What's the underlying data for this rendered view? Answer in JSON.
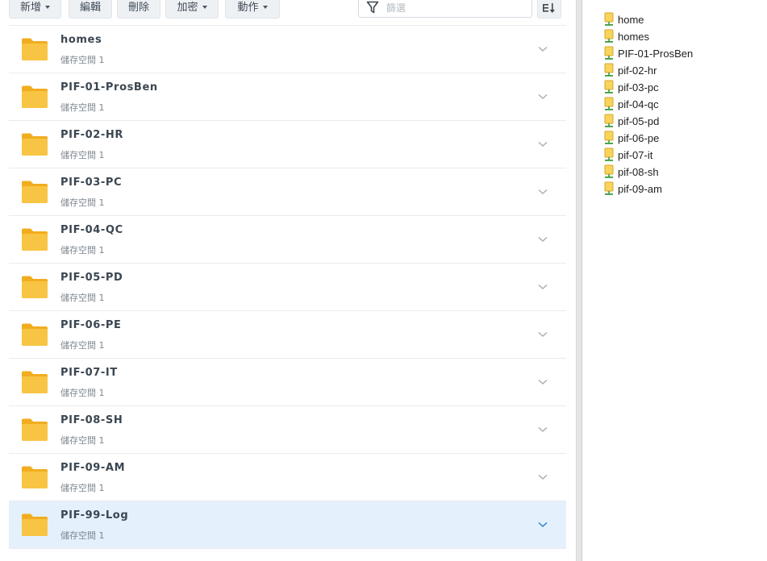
{
  "toolbar": {
    "create_label": "新增",
    "edit_label": "編輯",
    "delete_label": "刪除",
    "encrypt_label": "加密",
    "action_label": "動作",
    "search_placeholder": "篩選"
  },
  "folders": [
    {
      "name": "homes",
      "storage": "儲存空間 1",
      "selected": false
    },
    {
      "name": "PIF-01-ProsBen",
      "storage": "儲存空間 1",
      "selected": false
    },
    {
      "name": "PIF-02-HR",
      "storage": "儲存空間 1",
      "selected": false
    },
    {
      "name": "PIF-03-PC",
      "storage": "儲存空間 1",
      "selected": false
    },
    {
      "name": "PIF-04-QC",
      "storage": "儲存空間 1",
      "selected": false
    },
    {
      "name": "PIF-05-PD",
      "storage": "儲存空間 1",
      "selected": false
    },
    {
      "name": "PIF-06-PE",
      "storage": "儲存空間 1",
      "selected": false
    },
    {
      "name": "PIF-07-IT",
      "storage": "儲存空間 1",
      "selected": false
    },
    {
      "name": "PIF-08-SH",
      "storage": "儲存空間 1",
      "selected": false
    },
    {
      "name": "PIF-09-AM",
      "storage": "儲存空間 1",
      "selected": false
    },
    {
      "name": "PIF-99-Log",
      "storage": "儲存空間 1",
      "selected": true
    }
  ],
  "network_shares": [
    {
      "label": "home",
      "icon": "network-share-icon"
    },
    {
      "label": "homes",
      "icon": "network-share-icon"
    },
    {
      "label": "PIF-01-ProsBen",
      "icon": "network-share-icon"
    },
    {
      "label": "pif-02-hr",
      "icon": "network-share-icon"
    },
    {
      "label": "pif-03-pc",
      "icon": "network-share-icon"
    },
    {
      "label": "pif-04-qc",
      "icon": "network-share-icon"
    },
    {
      "label": "pif-05-pd",
      "icon": "network-share-icon"
    },
    {
      "label": "pif-06-pe",
      "icon": "network-share-icon"
    },
    {
      "label": "pif-07-it",
      "icon": "network-share-icon"
    },
    {
      "label": "pif-08-sh",
      "icon": "network-share-icon"
    },
    {
      "label": "pif-09-am",
      "icon": "network-share-icon"
    }
  ],
  "colors": {
    "folder": "#f8c443",
    "folder_dark": "#f1ad1f",
    "selected_row": "#e4f0fc",
    "chevron": "#a7afb7",
    "chevron_selected": "#2a80d0"
  }
}
